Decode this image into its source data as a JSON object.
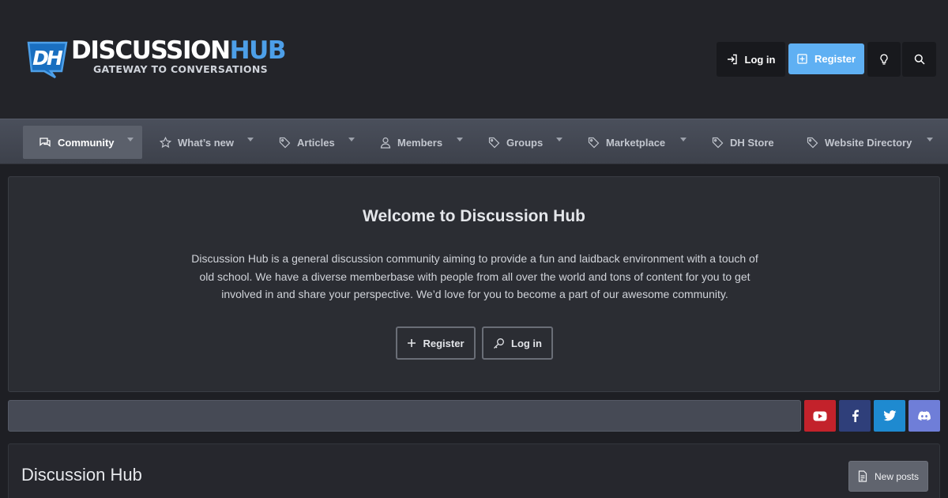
{
  "logo": {
    "word_part1": "DISCUSSION",
    "word_part2": "HUB",
    "mark_letters": "DH",
    "tagline": "GATEWAY TO CONVERSATIONS"
  },
  "header": {
    "login_label": "Log in",
    "register_label": "Register",
    "bulb_icon": "lightbulb-icon",
    "search_icon": "search-icon"
  },
  "nav": {
    "items": [
      {
        "label": "Community",
        "icon": "comments-icon",
        "active": true,
        "dropdown": true
      },
      {
        "label": "What’s new",
        "icon": "star-icon",
        "dropdown": true
      },
      {
        "label": "Articles",
        "icon": "tag-icon",
        "dropdown": true
      },
      {
        "label": "Members",
        "icon": "user-icon",
        "dropdown": true
      },
      {
        "label": "Groups",
        "icon": "tag-icon",
        "dropdown": true
      },
      {
        "label": "Marketplace",
        "icon": "tag-icon",
        "dropdown": true
      },
      {
        "label": "DH Store",
        "icon": "tag-icon",
        "dropdown": false
      },
      {
        "label": "Website Directory",
        "icon": "tag-icon",
        "dropdown": true
      }
    ]
  },
  "welcome": {
    "title": "Welcome to Discussion Hub",
    "text": "Discussion Hub is a general discussion community aiming to provide a fun and laidback environment with a touch of old school. We have a diverse memberbase with people from all over the world and tons of content for you to get involved in and share your perspective. We’d love for you to become a part of our awesome community.",
    "register_label": "Register",
    "login_label": "Log in"
  },
  "social": {
    "youtube_color": "#c3222b",
    "facebook_color": "#2f3f7a",
    "twitter_color": "#1e8ad0",
    "discord_color": "#6f7ed8"
  },
  "forum": {
    "title": "Discussion Hub",
    "new_posts_label": "New posts"
  },
  "colors": {
    "accent": "#5fb0f3",
    "background": "#1e1f24",
    "nav": "#4a4f5b"
  }
}
